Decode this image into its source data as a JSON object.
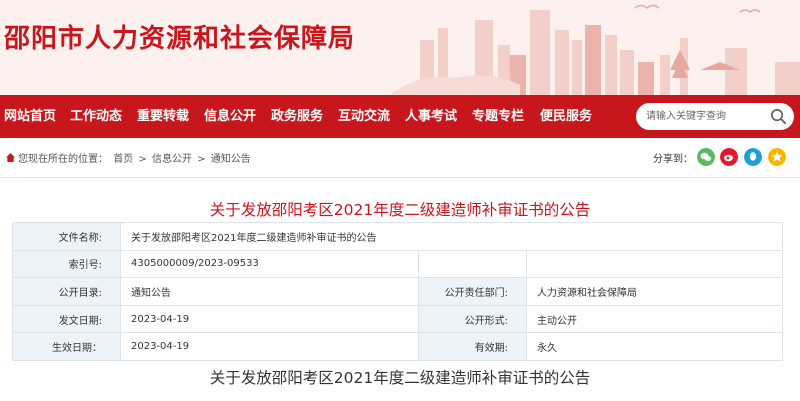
{
  "header": {
    "site_title": "邵阳市人力资源和社会保障局"
  },
  "nav": {
    "items": [
      {
        "label": "网站首页"
      },
      {
        "label": "工作动态"
      },
      {
        "label": "重要转载"
      },
      {
        "label": "信息公开"
      },
      {
        "label": "政务服务"
      },
      {
        "label": "互动交流"
      },
      {
        "label": "人事考试"
      },
      {
        "label": "专题专栏"
      },
      {
        "label": "便民服务"
      }
    ],
    "search_placeholder": "请输入关键字查询"
  },
  "breadcrumb": {
    "prefix": "您现在所在的位置：",
    "items": [
      "首页",
      "信息公开",
      "通知公告"
    ],
    "separator": ">"
  },
  "share": {
    "label": "分享到：",
    "icons": [
      "wechat-icon",
      "weibo-icon",
      "qq-icon",
      "qzone-icon"
    ]
  },
  "article": {
    "title": "关于发放邵阳考区2021年度二级建造师补审证书的公告",
    "meta": {
      "file_name_label": "文件名称:",
      "file_name": "关于发放邵阳考区2021年度二级建造师补审证书的公告",
      "index_label": "索引号:",
      "index": "4305000009/2023-09533",
      "catalog_label": "公开目录:",
      "catalog": "通知公告",
      "dept_label": "公开责任部门:",
      "dept": "人力资源和社会保障局",
      "issue_date_label": "发文日期:",
      "issue_date": "2023-04-19",
      "form_label": "公开形式:",
      "form": "主动公开",
      "effective_date_label": "生效日期：",
      "effective_date": "2023-04-19",
      "validity_label": "有效期:",
      "validity": "永久"
    },
    "subtitle": "关于发放邵阳考区2021年度二级建造师补审证书的公告"
  },
  "colors": {
    "brand_red": "#c8161d",
    "label_bg": "#eef3f8",
    "header_bg": "#fdf1ef"
  }
}
